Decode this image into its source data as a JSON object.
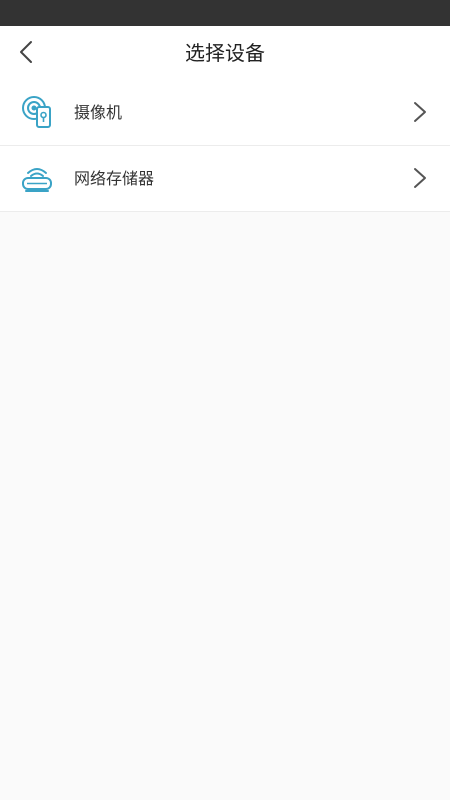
{
  "status_bar": {},
  "header": {
    "back_icon": "chevron-left-icon",
    "title": "选择设备"
  },
  "device_list": [
    {
      "label": "摄像机",
      "icon": "camera-icon"
    },
    {
      "label": "网络存储器",
      "icon": "network-storage-icon"
    }
  ],
  "colors": {
    "accent": "#3aa3c6",
    "status_bar": "#333333",
    "background": "#fafafa"
  }
}
